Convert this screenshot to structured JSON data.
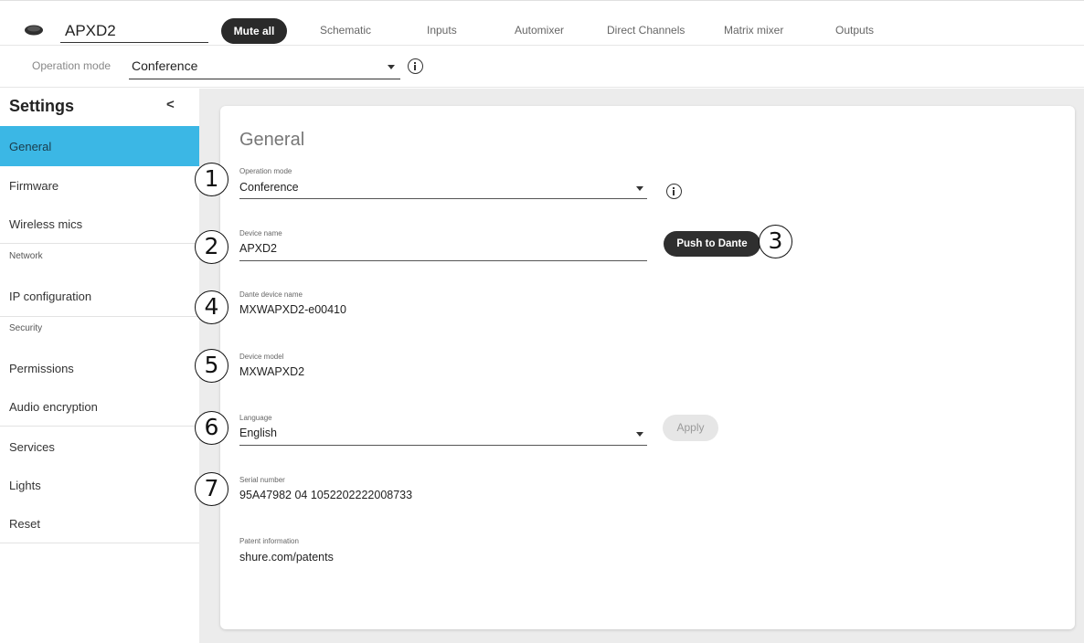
{
  "header": {
    "device_name": "APXD2",
    "mute_all_label": "Mute all",
    "tabs": [
      {
        "label": "Schematic"
      },
      {
        "label": "Inputs"
      },
      {
        "label": "Automixer"
      },
      {
        "label": "Direct Channels"
      },
      {
        "label": "Matrix mixer"
      },
      {
        "label": "Outputs"
      }
    ]
  },
  "operation_bar": {
    "label": "Operation mode",
    "value": "Conference"
  },
  "sidebar": {
    "title": "Settings",
    "collapse_glyph": "<",
    "items": [
      {
        "label": "General",
        "active": true
      },
      {
        "label": "Firmware"
      },
      {
        "label": "Wireless mics"
      },
      {
        "label": "IP configuration"
      },
      {
        "label": "Permissions"
      },
      {
        "label": "Audio encryption"
      },
      {
        "label": "Services"
      },
      {
        "label": "Lights"
      },
      {
        "label": "Reset"
      }
    ],
    "sections": {
      "network": "Network",
      "security": "Security"
    }
  },
  "general": {
    "title": "General",
    "operation_mode": {
      "label": "Operation mode",
      "value": "Conference"
    },
    "device_name": {
      "label": "Device name",
      "value": "APXD2"
    },
    "push_to_dante_label": "Push to Dante",
    "dante_device_name": {
      "label": "Dante device name",
      "value": "MXWAPXD2-e00410"
    },
    "device_model": {
      "label": "Device model",
      "value": "MXWAPXD2"
    },
    "language": {
      "label": "Language",
      "value": "English"
    },
    "apply_label": "Apply",
    "serial_number": {
      "label": "Serial number",
      "value": "95A47982 04 1052202222008733"
    },
    "patent_information": {
      "label": "Patent information",
      "value": "shure.com/patents"
    }
  },
  "callouts": [
    "1",
    "2",
    "3",
    "4",
    "5",
    "6",
    "7"
  ],
  "colors": {
    "accent_active": "#3bb7e5",
    "button_dark": "#2a2a2a",
    "main_background": "#ececec"
  },
  "icons": {
    "device": "microphone-device-icon",
    "info": "info-icon",
    "dropdown": "chevron-down-icon"
  }
}
